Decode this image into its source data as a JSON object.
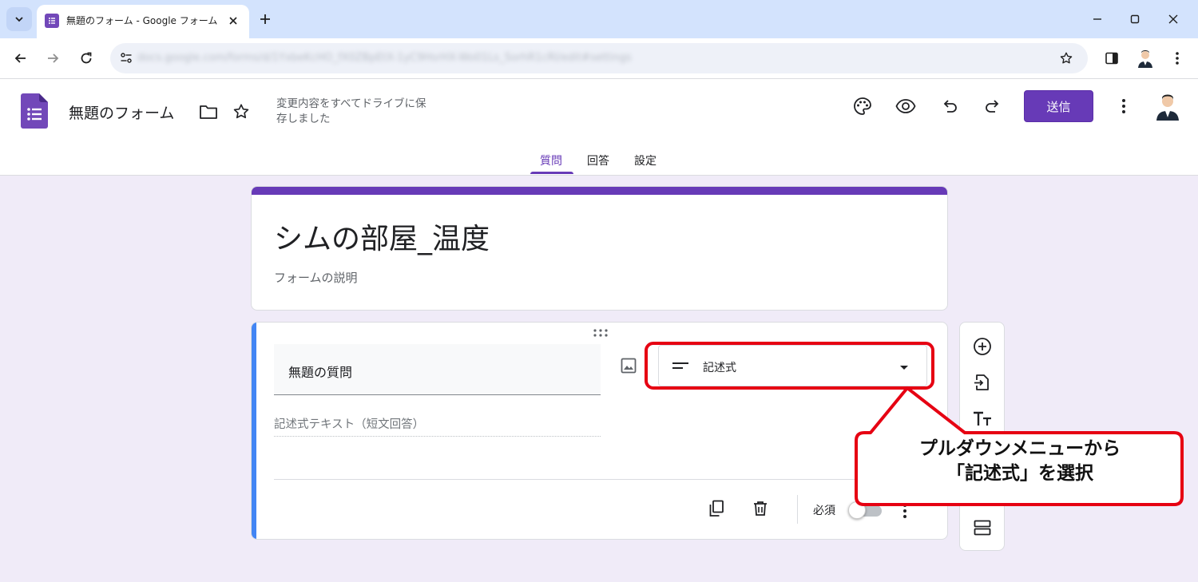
{
  "browser": {
    "tab_title": "無題のフォーム - Google フォーム",
    "url": "docs.google.com/forms/d/1YxbeKcHO_fX0ZBpEtX-1yC9HsrHX-Wo01Ls_SorhR1cRI/edit#settings"
  },
  "header": {
    "doc_title": "無題のフォーム",
    "save_status": "変更内容をすべてドライブに保存しました",
    "send_label": "送信",
    "tabs": [
      {
        "label": "質問",
        "active": true
      },
      {
        "label": "回答",
        "active": false
      },
      {
        "label": "設定",
        "active": false
      }
    ]
  },
  "form": {
    "title": "シムの部屋_温度",
    "description_placeholder": "フォームの説明"
  },
  "question": {
    "title": "無題の質問",
    "type": "記述式",
    "answer_hint": "記述式テキスト（短文回答）",
    "required_label": "必須",
    "required": false
  },
  "annotation": {
    "line1": "プルダウンメニューから",
    "line2": "「記述式」を選択",
    "color": "#e60012"
  },
  "colors": {
    "accent": "#673ab7",
    "focus_bar": "#4285f4",
    "background": "#f0ebf8"
  }
}
